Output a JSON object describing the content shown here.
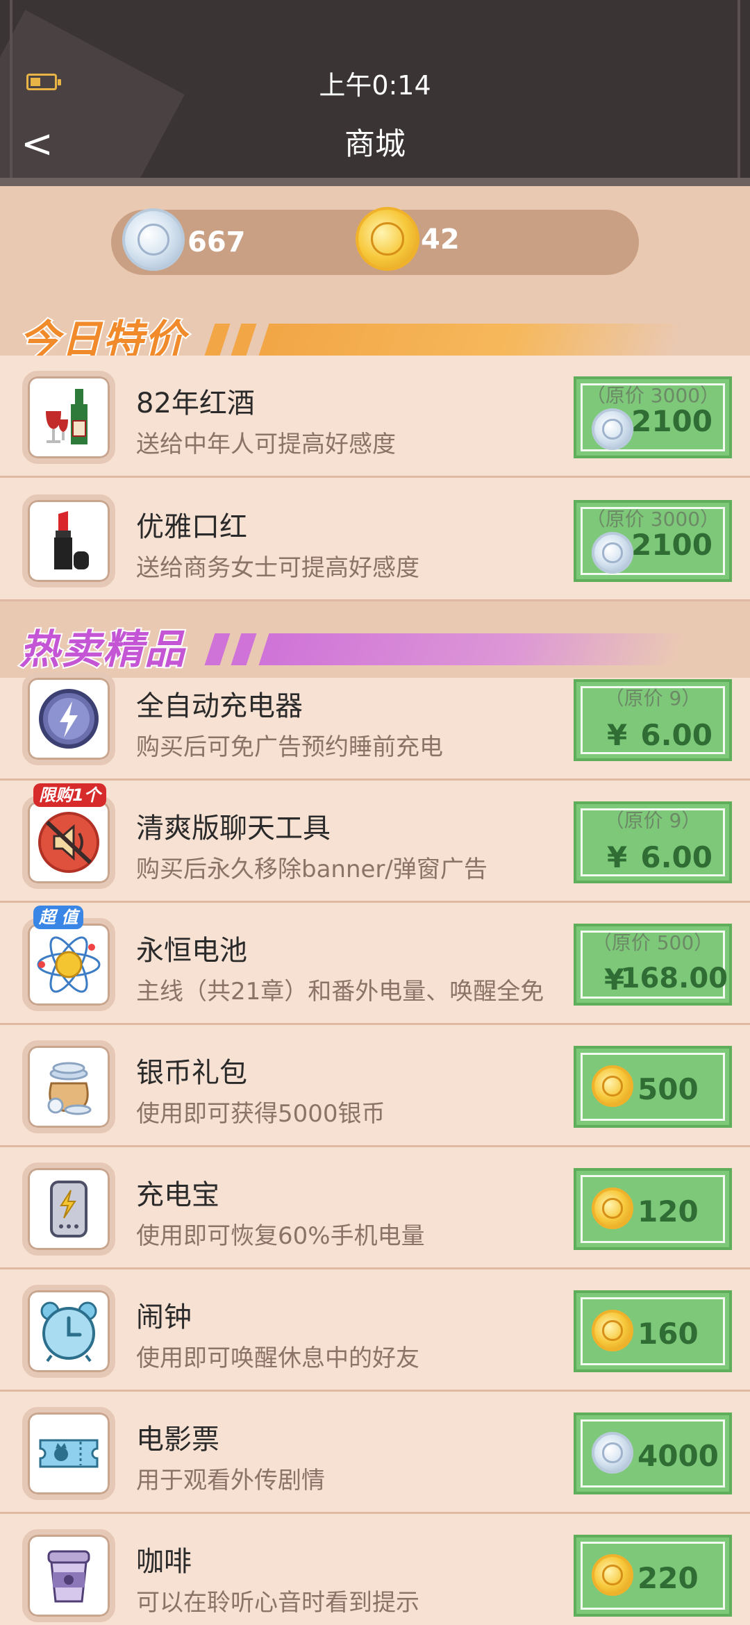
{
  "status_bar": {
    "time": "上午0:14"
  },
  "header": {
    "back": "<",
    "title": "商城"
  },
  "currency": {
    "silver": "667",
    "gold": "42"
  },
  "sections": {
    "daily": "今日特价",
    "hot": "热卖精品"
  },
  "daily_items": [
    {
      "name": "82年红酒",
      "desc": "送给中年人可提高好感度",
      "orig": "（原价 3000）",
      "price": "2100",
      "coin": "silver",
      "icon": "wine-bottle-icon"
    },
    {
      "name": "优雅口红",
      "desc": "送给商务女士可提高好感度",
      "orig": "（原价 3000）",
      "price": "2100",
      "coin": "silver",
      "icon": "lipstick-icon"
    }
  ],
  "hot_items": [
    {
      "name": "全自动充电器",
      "desc": "购买后可免广告预约睡前充电",
      "orig": "（原价 9）",
      "price": "6.00",
      "currency_symbol": "¥",
      "icon": "lightning-charger-icon"
    },
    {
      "name": "清爽版聊天工具",
      "desc": "购买后永久移除banner/弹窗广告",
      "orig": "（原价 9）",
      "price": "6.00",
      "currency_symbol": "¥",
      "badge": "限购1个",
      "icon": "no-speaker-icon"
    },
    {
      "name": "永恒电池",
      "desc": "主线（共21章）和番外电量、唤醒全免",
      "orig": "（原价 500）",
      "price": "168.00",
      "currency_symbol": "¥",
      "badge": "超 值",
      "icon": "atom-battery-icon"
    },
    {
      "name": "银币礼包",
      "desc": "使用即可获得5000银币",
      "price": "500",
      "coin": "gold",
      "icon": "coin-bag-icon"
    },
    {
      "name": "充电宝",
      "desc": "使用即可恢复60%手机电量",
      "price": "120",
      "coin": "gold",
      "icon": "power-bank-icon"
    },
    {
      "name": "闹钟",
      "desc": "使用即可唤醒休息中的好友",
      "price": "160",
      "coin": "gold",
      "icon": "alarm-clock-icon"
    },
    {
      "name": "电影票",
      "desc": "用于观看外传剧情",
      "price": "4000",
      "coin": "silver",
      "icon": "ticket-icon"
    },
    {
      "name": "咖啡",
      "desc": "可以在聆听心音时看到提示",
      "price": "220",
      "coin": "gold",
      "icon": "coffee-cup-icon"
    }
  ],
  "colors": {
    "header_bg": "#3b3434",
    "page_bg": "#f6e0d2",
    "price_green": "#7ec87a",
    "daily_orange": "#f08a2a",
    "hot_purple": "#c456d6"
  }
}
